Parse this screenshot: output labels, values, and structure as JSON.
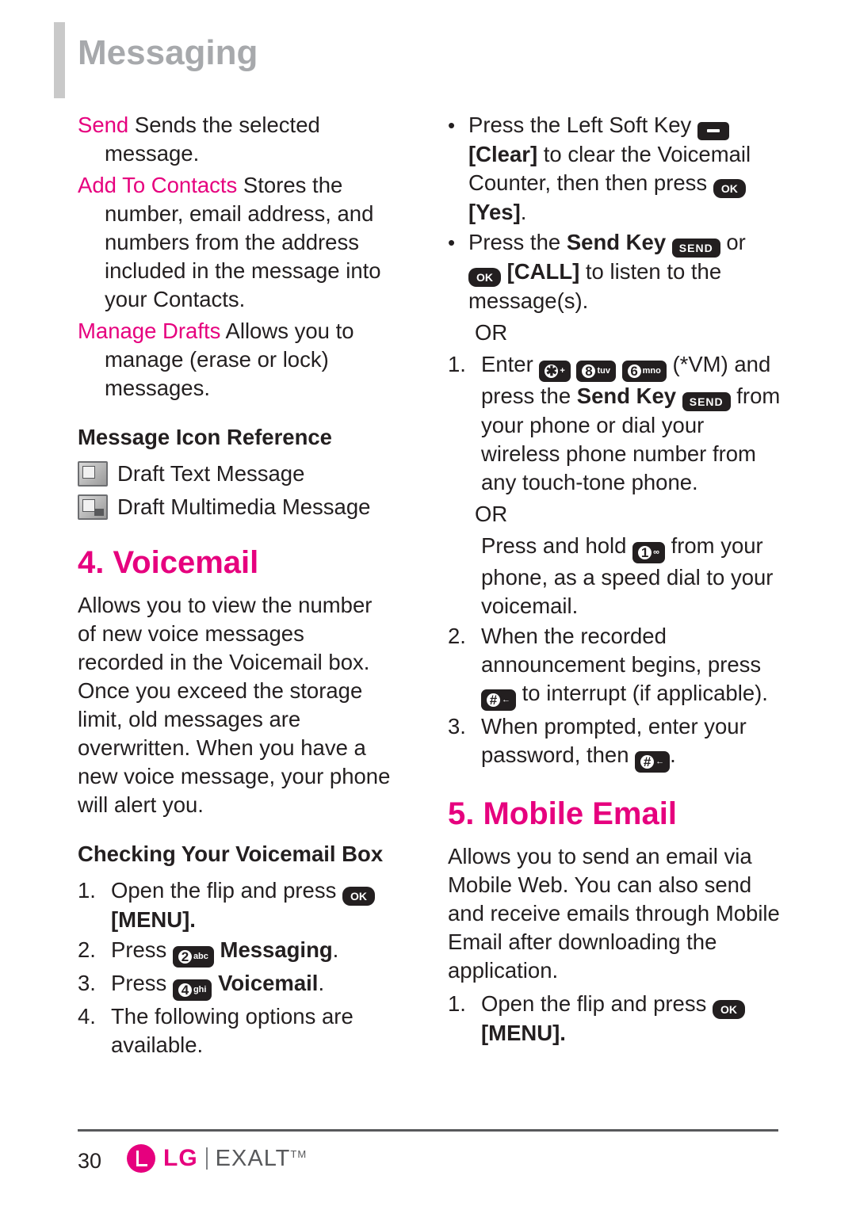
{
  "header": {
    "title": "Messaging"
  },
  "left_column": {
    "send_term": "Send",
    "send_desc": " Sends the selected message.",
    "add_term": "Add To Contacts",
    "add_desc": " Stores the number, email address, and numbers from the address included in the message into your Contacts.",
    "drafts_term": "Manage Drafts",
    "drafts_desc": " Allows you to manage (erase or lock) messages.",
    "icon_ref_heading": "Message Icon Reference",
    "icon_draft_text": "Draft Text Message",
    "icon_draft_multimedia": "Draft Multimedia Message",
    "voicemail_title": "4. Voicemail",
    "voicemail_body": "Allows you to view the number of new voice messages recorded in the Voicemail box. Once you exceed the storage limit, old messages are overwritten. When you have a new voice message, your phone will alert you.",
    "checking_heading": "Checking Your Voicemail Box",
    "step1_num": "1.",
    "step1_a": "Open the flip and press",
    "step1_key": "OK",
    "step1_b": "[MENU].",
    "step2_num": "2.",
    "step2_a": "Press",
    "step2_key_num": "2",
    "step2_key_sub": "abc",
    "step2_b": "Messaging",
    "step2_period": ".",
    "step3_num": "3.",
    "step3_a": "Press",
    "step3_key_num": "4",
    "step3_key_sub": "ghi",
    "step3_b": "Voicemail",
    "step3_period": ".",
    "step4_num": "4.",
    "step4_text": "The following options are available."
  },
  "right_column": {
    "bullet1_a": "Press the Left Soft Key",
    "bullet1_b": "[Clear]",
    "bullet1_c": " to clear the Voicemail Counter, then then press",
    "bullet1_key": "OK",
    "bullet1_d": "[Yes]",
    "bullet1_e": ".",
    "bullet2_a": "Press the",
    "bullet2_bold": "Send Key",
    "bullet2_key": "SEND",
    "bullet2_b": " or",
    "bullet2_key2": "OK",
    "bullet2_c": "[CALL]",
    "bullet2_d": " to listen to the message(s).",
    "or1": "OR",
    "step1_num": "1.",
    "step1_a": "Enter",
    "step1_key1_num": "✱",
    "step1_key1_sub": "+",
    "step1_key2_num": "8",
    "step1_key2_sub": "tuv",
    "step1_key3_num": "6",
    "step1_key3_sub": "mno",
    "step1_b": "(*VM) and press the",
    "step1_bold": "Send Key",
    "step1_key4": "SEND",
    "step1_c": " from your phone or dial your wireless phone number from any touch-tone phone.",
    "or2": "OR",
    "hold_a": "Press and hold",
    "hold_key_num": "1",
    "hold_key_sub": "∞",
    "hold_b": "from your phone, as a speed dial to your voicemail.",
    "step2_num": "2.",
    "step2_a": "When the recorded announcement begins, press",
    "step2_key_num": "#",
    "step2_key_sub": "←",
    "step2_b": "to interrupt (if applicable).",
    "step3_num": "3.",
    "step3_a": "When prompted, enter your password, then",
    "step3_key_num": "#",
    "step3_key_sub": "←",
    "step3_b": ".",
    "mobile_email_title": "5. Mobile Email",
    "mobile_email_body": "Allows you to send an email via Mobile Web. You can also send and receive emails through Mobile Email after downloading the application.",
    "me_step1_num": "1.",
    "me_step1_a": "Open the flip and press",
    "me_step1_key": "OK",
    "me_step1_b": "[MENU]."
  },
  "footer": {
    "page_number": "30",
    "brand": "LG",
    "model": "EXALT",
    "tm": "TM"
  },
  "colors": {
    "accent": "#e6007e",
    "header_gray": "#a7a9ac",
    "text": "#231f20"
  }
}
